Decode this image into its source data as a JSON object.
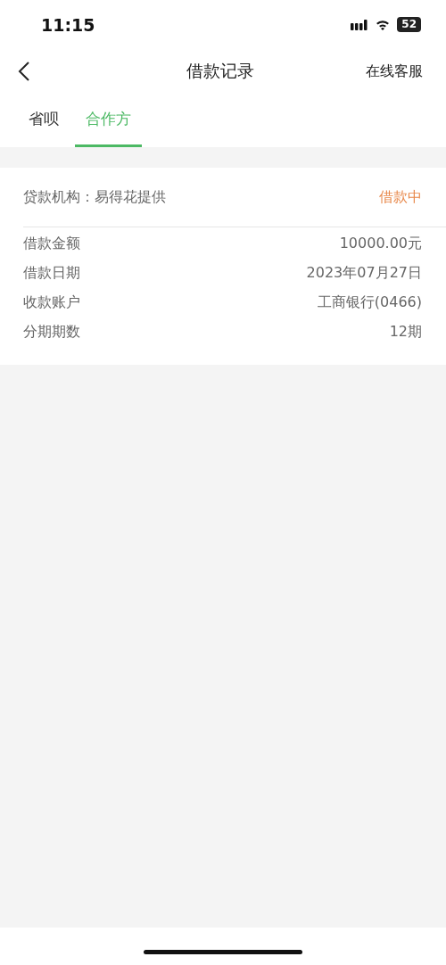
{
  "status_bar": {
    "time": "11:15",
    "battery": "52"
  },
  "nav": {
    "title": "借款记录",
    "action": "在线客服"
  },
  "tabs": [
    {
      "label": "省呗",
      "selected": false
    },
    {
      "label": "合作方",
      "selected": true
    }
  ],
  "loan": {
    "lender": "贷款机构：易得花提供",
    "status": "借款中",
    "rows": [
      {
        "label": "借款金额",
        "value": "10000.00元"
      },
      {
        "label": "借款日期",
        "value": "2023年07月27日"
      },
      {
        "label": "收款账户",
        "value": "工商银行(0466)"
      },
      {
        "label": "分期期数",
        "value": "12期"
      }
    ]
  }
}
